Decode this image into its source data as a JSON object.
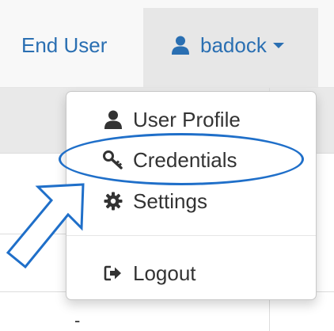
{
  "navbar": {
    "end_user_label": "End User",
    "username": "badock"
  },
  "dropdown": {
    "items": [
      {
        "label": "User Profile",
        "icon": "user-icon"
      },
      {
        "label": "Credentials",
        "icon": "key-icon"
      },
      {
        "label": "Settings",
        "icon": "gear-icon"
      },
      {
        "label": "Logout",
        "icon": "sign-out-icon"
      }
    ]
  },
  "table": {
    "cell_value": "-"
  },
  "colors": {
    "link": "#2a6fb2",
    "annotation": "#1f6fc9",
    "navbar_bg": "#f8f8f8",
    "active_bg": "#e7e7e7"
  }
}
